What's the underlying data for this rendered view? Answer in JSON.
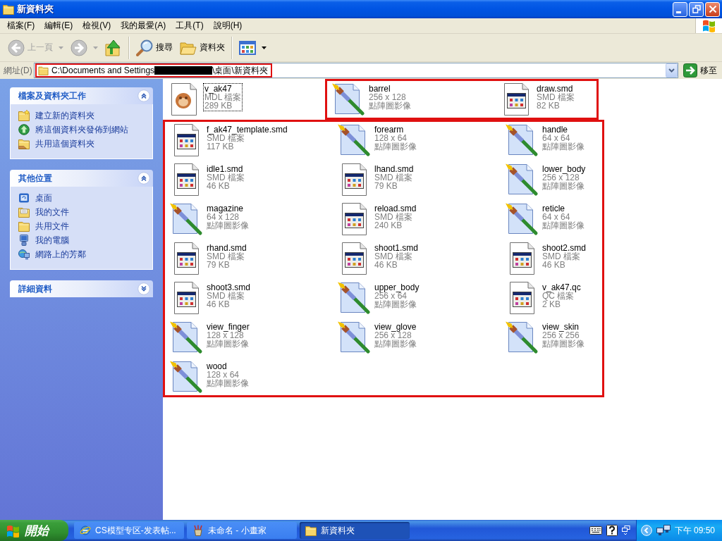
{
  "window": {
    "title": "新資料夾"
  },
  "menu": [
    "檔案(F)",
    "編輯(E)",
    "檢視(V)",
    "我的最愛(A)",
    "工具(T)",
    "說明(H)"
  ],
  "toolbar": {
    "groups": [
      [
        {
          "kind": "back",
          "label": "上一頁",
          "disabled": true
        },
        {
          "kind": "forward",
          "disabled": true
        },
        {
          "kind": "up",
          "disabled": false
        }
      ],
      [
        {
          "kind": "search",
          "label": "搜尋",
          "disabled": false
        },
        {
          "kind": "folders",
          "label": "資料夾",
          "disabled": false
        }
      ],
      [
        {
          "kind": "views",
          "disabled": false
        }
      ]
    ]
  },
  "address_bar": {
    "label": "網址(D)",
    "path_start": "C:\\Documents and Settings",
    "redacted": true,
    "path_end": "\\桌面\\新資料夾",
    "marked": true,
    "go_label": "移至"
  },
  "sidebar": {
    "panels": [
      {
        "title": "檔案及資料夾工作",
        "expanded": true,
        "items": [
          {
            "kind": "new_folder",
            "label": "建立新的資料夾"
          },
          {
            "kind": "publish",
            "label": "將這個資料夾發佈到網站"
          },
          {
            "kind": "share",
            "label": "共用這個資料夾"
          }
        ]
      },
      {
        "title": "其他位置",
        "expanded": true,
        "items": [
          {
            "kind": "desktop",
            "label": "桌面"
          },
          {
            "kind": "documents",
            "label": "我的文件"
          },
          {
            "kind": "shared",
            "label": "共用文件"
          },
          {
            "kind": "computer",
            "label": "我的電腦"
          },
          {
            "kind": "network",
            "label": "網路上的芳鄰"
          }
        ]
      },
      {
        "title": "詳細資料",
        "expanded": false
      }
    ]
  },
  "file_groups": [
    {
      "marked": false,
      "files": [
        {
          "kind": "model",
          "name": "v_ak47",
          "details": [
            "MDL 檔案",
            "289 KB"
          ],
          "focused": true
        }
      ]
    },
    {
      "marked": true,
      "files": [
        {
          "kind": "image",
          "name": "barrel",
          "details": [
            "256 x 128",
            "點陣圖影像"
          ],
          "focused": false
        },
        {
          "kind": "document",
          "name": "draw.smd",
          "details": [
            "SMD 檔案",
            "82 KB"
          ],
          "focused": false
        }
      ]
    },
    {
      "marked": true,
      "files": [
        {
          "kind": "document",
          "name": "f_ak47_template.smd",
          "details": [
            "SMD 檔案",
            "117 KB"
          ],
          "focused": false
        },
        {
          "kind": "image",
          "name": "forearm",
          "details": [
            "128 x 64",
            "點陣圖影像"
          ],
          "focused": false
        },
        {
          "kind": "image",
          "name": "handle",
          "details": [
            "64 x 64",
            "點陣圖影像"
          ],
          "focused": false
        },
        {
          "kind": "document",
          "name": "idle1.smd",
          "details": [
            "SMD 檔案",
            "46 KB"
          ],
          "focused": false
        },
        {
          "kind": "document",
          "name": "lhand.smd",
          "details": [
            "SMD 檔案",
            "79 KB"
          ],
          "focused": false
        },
        {
          "kind": "image",
          "name": "lower_body",
          "details": [
            "256 x 128",
            "點陣圖影像"
          ],
          "focused": false
        },
        {
          "kind": "image",
          "name": "magazine",
          "details": [
            "64 x 128",
            "點陣圖影像"
          ],
          "focused": false
        },
        {
          "kind": "document",
          "name": "reload.smd",
          "details": [
            "SMD 檔案",
            "240 KB"
          ],
          "focused": false
        },
        {
          "kind": "image",
          "name": "reticle",
          "details": [
            "64 x 64",
            "點陣圖影像"
          ],
          "focused": false
        },
        {
          "kind": "document",
          "name": "rhand.smd",
          "details": [
            "SMD 檔案",
            "79 KB"
          ],
          "focused": false
        },
        {
          "kind": "document",
          "name": "shoot1.smd",
          "details": [
            "SMD 檔案",
            "46 KB"
          ],
          "focused": false
        },
        {
          "kind": "document",
          "name": "shoot2.smd",
          "details": [
            "SMD 檔案",
            "46 KB"
          ],
          "focused": false
        },
        {
          "kind": "document",
          "name": "shoot3.smd",
          "details": [
            "SMD 檔案",
            "46 KB"
          ],
          "focused": false
        },
        {
          "kind": "image",
          "name": "upper_body",
          "details": [
            "256 x 64",
            "點陣圖影像"
          ],
          "focused": false
        },
        {
          "kind": "document",
          "name": "v_ak47.qc",
          "details": [
            "QC 檔案",
            "2 KB"
          ],
          "focused": false
        },
        {
          "kind": "image",
          "name": "view_finger",
          "details": [
            "128 x 128",
            "點陣圖影像"
          ],
          "focused": false
        },
        {
          "kind": "image",
          "name": "view_glove",
          "details": [
            "256 x 128",
            "點陣圖影像"
          ],
          "focused": false
        },
        {
          "kind": "image",
          "name": "view_skin",
          "details": [
            "256 x 256",
            "點陣圖影像"
          ],
          "focused": false
        },
        {
          "kind": "image",
          "name": "wood",
          "details": [
            "128 x 64",
            "點陣圖影像"
          ],
          "focused": false
        }
      ]
    }
  ],
  "taskbar": {
    "start": "開始",
    "tasks": [
      {
        "kind": "browser",
        "label": "CS模型专区-发表帖...",
        "selected": false
      },
      {
        "kind": "paint",
        "label": "未命名 - 小畫家",
        "selected": false
      },
      {
        "kind": "folder",
        "label": "新資料夾",
        "selected": true
      }
    ],
    "clock": "下午 09:50"
  }
}
